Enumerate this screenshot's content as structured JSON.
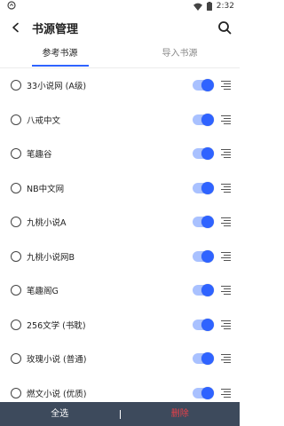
{
  "statusbar": {
    "time": "2:32",
    "app_icon": "app-notification-icon",
    "wifi_icon": "wifi-icon",
    "battery_icon": "battery-icon"
  },
  "appbar": {
    "title": "书源管理",
    "back_icon": "back-arrow-icon",
    "search_icon": "search-icon"
  },
  "tabs": [
    {
      "label": "参考书源",
      "active": true
    },
    {
      "label": "导入书源",
      "active": false
    }
  ],
  "sources": [
    {
      "name": "33小说网 (A级)",
      "enabled": true
    },
    {
      "name": "八戒中文",
      "enabled": true
    },
    {
      "name": "笔趣谷",
      "enabled": true
    },
    {
      "name": "NB中文网",
      "enabled": true
    },
    {
      "name": "九桃小说A",
      "enabled": true
    },
    {
      "name": "九桃小说网B",
      "enabled": true
    },
    {
      "name": "笔趣阁G",
      "enabled": true
    },
    {
      "name": "256文学 (书耽)",
      "enabled": true
    },
    {
      "name": "玫瑰小说 (普通)",
      "enabled": true
    },
    {
      "name": "燃文小说 (优质)",
      "enabled": true
    }
  ],
  "bottom": {
    "select_all": "全选",
    "delete": "删除"
  },
  "colors": {
    "accent": "#2f63ff",
    "toggle_track": "#a9c1ff",
    "bottom_bar": "#3d4a5c",
    "delete": "#e8414a"
  }
}
